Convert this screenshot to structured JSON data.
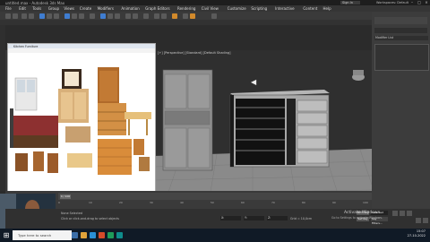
{
  "window": {
    "title": "untitled.max - Autodesk 3ds Max",
    "sign_in": "Sign In",
    "workspaces": "Workspaces: Default"
  },
  "menus": [
    "File",
    "Edit",
    "Tools",
    "Group",
    "Views",
    "Create",
    "Modifiers",
    "Animation",
    "Graph Editors",
    "Rendering",
    "Civil View",
    "Customize",
    "Scripting",
    "Interactive",
    "Content",
    "Help"
  ],
  "viewport": {
    "label": "[+] [Perspective] [Standard] [Default Shading]"
  },
  "browser": {
    "tab_title": "Kitchen Furniture",
    "zoom": "100%"
  },
  "command_panel": {
    "modifier_list": "Modifier List"
  },
  "timeline": {
    "frame": "0 / 100",
    "ticks": [
      "0",
      "10",
      "20",
      "30",
      "40",
      "50",
      "60",
      "70",
      "80",
      "90",
      "100"
    ]
  },
  "status": {
    "msg1": "None Selected",
    "msg2": "Click or click-and-drag to select objects",
    "x": "X:",
    "y": "Y:",
    "z": "Z:",
    "grid": "Grid = 10,0cm",
    "auto_key": "Auto Key",
    "selected": "Selected",
    "set_key": "Set Key",
    "key_filters": "Key Filters..."
  },
  "activate": {
    "line1": "Activate Windows",
    "line2": "Go to Settings to activate Windows."
  },
  "taskbar": {
    "search": "Type here to search",
    "time": "15:07",
    "date": "27-10-2022"
  },
  "colors": {
    "accent": "#3f7dd1",
    "bg": "#2b2b2b"
  }
}
